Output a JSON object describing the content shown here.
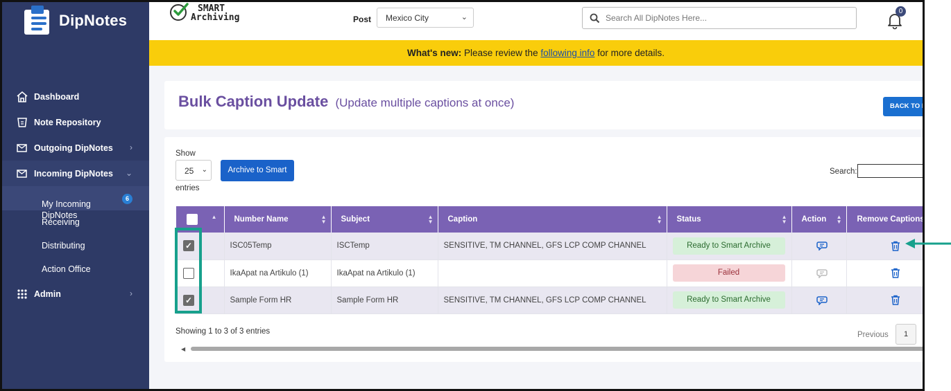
{
  "sidebar": {
    "brand": "DipNotes",
    "items": [
      {
        "label": "Dashboard",
        "icon": "home-icon"
      },
      {
        "label": "Note Repository",
        "icon": "repository-icon"
      },
      {
        "label": "Outgoing DipNotes",
        "icon": "outgoing-mail-icon"
      },
      {
        "label": "Incoming DipNotes",
        "icon": "incoming-mail-icon"
      }
    ],
    "sub_items": [
      {
        "label": "My Incoming\nDipNotes",
        "badge": "6"
      },
      {
        "label": "Receiving"
      },
      {
        "label": "Distributing"
      },
      {
        "label": "Action Office"
      }
    ],
    "admin_label": "Admin"
  },
  "header": {
    "logo_line1": "SMART",
    "logo_line2": "Archiving",
    "post_label": "Post",
    "post_value": "Mexico City",
    "search_placeholder": "Search All DipNotes Here...",
    "notification_count": "0"
  },
  "banner": {
    "bold": "What's new:",
    "pre_link": "Please review the",
    "link": "following info",
    "post_link": "for more details."
  },
  "page": {
    "title": "Bulk Caption Update",
    "subtitle": "(Update multiple captions at once)",
    "back_button": "BACK TO L"
  },
  "table_controls": {
    "show_label": "Show",
    "page_length": "25",
    "entries_label": "entries",
    "archive_button": "Archive to Smart",
    "search_label": "Search:"
  },
  "table": {
    "columns": [
      "Number Name",
      "Subject",
      "Caption",
      "Status",
      "Action",
      "Remove Captions"
    ],
    "rows": [
      {
        "checked": true,
        "number_name": "ISC05Temp",
        "subject": "ISCTemp",
        "caption": "SENSITIVE, TM CHANNEL, GFS LCP COMP CHANNEL",
        "status": "Ready to Smart Archive",
        "status_type": "ok"
      },
      {
        "checked": false,
        "number_name": "IkaApat na Artikulo (1)",
        "subject": "IkaApat na Artikulo (1)",
        "caption": "",
        "status": "Failed",
        "status_type": "fail"
      },
      {
        "checked": true,
        "number_name": "Sample Form HR",
        "subject": "Sample Form HR",
        "caption": "SENSITIVE, TM CHANNEL, GFS LCP COMP CHANNEL",
        "status": "Ready to Smart Archive",
        "status_type": "ok"
      }
    ]
  },
  "footer": {
    "info": "Showing 1 to 3 of 3 entries",
    "previous": "Previous",
    "page": "1"
  },
  "colors": {
    "sidebar": "#2e3a66",
    "banner": "#f9cd0b",
    "table_header": "#7a62b4",
    "primary_button": "#1a62c9",
    "annotation": "#17a08c"
  }
}
